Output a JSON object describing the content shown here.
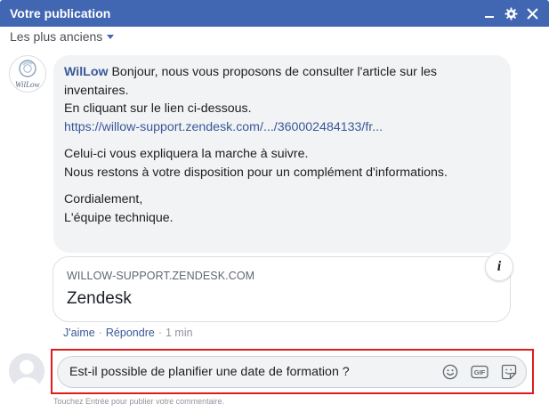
{
  "window": {
    "title": "Votre publication",
    "controls": [
      "minimize-icon",
      "gear-icon",
      "close-icon"
    ],
    "accent": "#4267b2"
  },
  "sort": {
    "label": "Les plus anciens"
  },
  "comment": {
    "avatar": {
      "logo_text": "WilLow"
    },
    "author": "WilLow",
    "lines": {
      "l1": " Bonjour, nous vous proposons de consulter l'article sur les inventaires.",
      "l2": "En cliquant sur le lien ci-dessous.",
      "link": "https://willow-support.zendesk.com/.../360002484133/fr...",
      "p2a": "Celui-ci vous expliquera la marche à suivre.",
      "p2b": "Nous restons à votre disposition pour un complément d'informations.",
      "p3a": "Cordialement,",
      "p3b": "L'équipe technique."
    },
    "link_preview": {
      "domain": "WILLOW-SUPPORT.ZENDESK.COM",
      "title": "Zendesk",
      "info_glyph": "i"
    },
    "actions": {
      "like": "J'aime",
      "reply": "Répondre",
      "time": "1 min",
      "separator": "·"
    }
  },
  "reply_box": {
    "value": "Est-il possible de planifier une date de formation ?",
    "tools": [
      "emoji-icon",
      "gif-icon",
      "sticker-icon"
    ],
    "gif_label": "GIF",
    "hint": "Touchez Entrée pour publier votre commentaire."
  },
  "colors": {
    "link": "#385898",
    "highlight": "#e01b1b",
    "bubble": "#f2f3f5"
  }
}
